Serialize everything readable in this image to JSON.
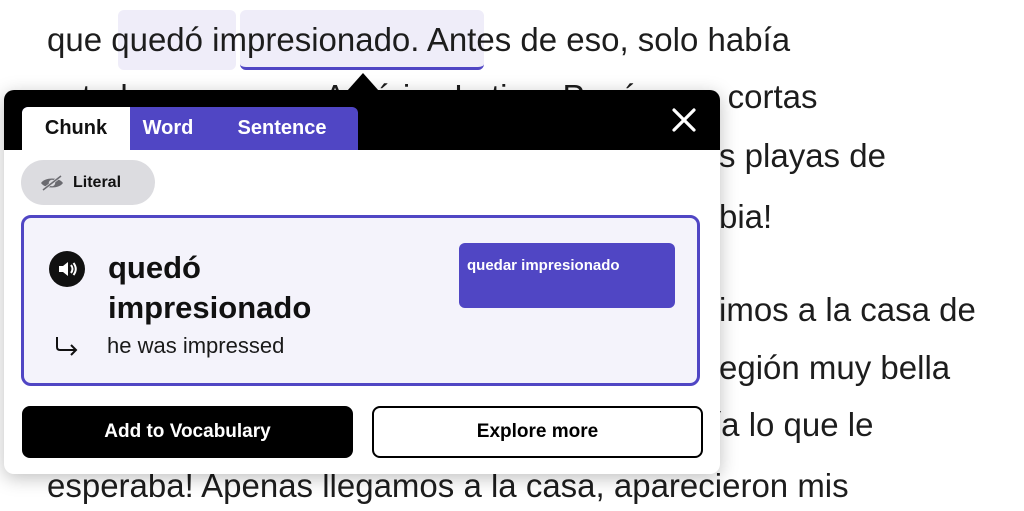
{
  "reader": {
    "lines": [
      {
        "parts": [
          "que ",
          "quedó",
          " ",
          "impresionado",
          ". Antes de eso, solo había"
        ]
      },
      {
        "text": "estado una vez en América Latina. Pasó unas cortas"
      },
      {
        "text": "s playas de"
      },
      {
        "text": "bia!"
      },
      {
        "text": "imos a la casa de"
      },
      {
        "text": "egión muy bella"
      },
      {
        "text": "ía lo que le"
      },
      {
        "text": "esperaba! Apenas llegamos a la casa, aparecieron mis"
      }
    ]
  },
  "popup": {
    "tabs": [
      {
        "label": "Chunk",
        "active": true
      },
      {
        "label": "Word",
        "active": false
      },
      {
        "label": "Sentence",
        "active": false
      }
    ],
    "close_icon": "close-icon",
    "literal_toggle": {
      "label": "Literal",
      "icon": "eye-slash-icon"
    },
    "card": {
      "phrase": "quedó impresionado",
      "translation": "he was impressed",
      "lemma": "quedar impresionado",
      "audio_icon": "speaker-icon"
    },
    "actions": {
      "add_vocab": "Add to Vocabulary",
      "explore": "Explore more"
    }
  },
  "colors": {
    "accent": "#5046c4",
    "highlight": "#efedf9",
    "header": "#000000"
  }
}
